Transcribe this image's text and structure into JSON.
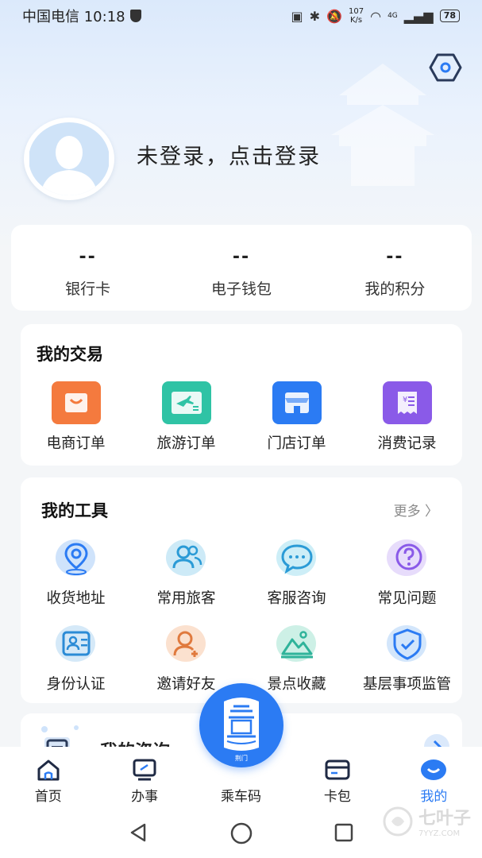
{
  "status_bar": {
    "carrier_time": "中国电信 10:18",
    "net_speed_value": "107",
    "net_speed_unit": "K/s",
    "signal_label": "4G",
    "battery": "78"
  },
  "profile": {
    "login_prompt": "未登录，点击登录"
  },
  "assets": [
    {
      "value": "--",
      "label": "银行卡"
    },
    {
      "value": "--",
      "label": "电子钱包"
    },
    {
      "value": "--",
      "label": "我的积分"
    }
  ],
  "trade": {
    "title": "我的交易",
    "items": [
      {
        "label": "电商订单",
        "icon": "shopping-bag-icon",
        "color": "#f47a3e"
      },
      {
        "label": "旅游订单",
        "icon": "airplane-ticket-icon",
        "color": "#2fc3a5"
      },
      {
        "label": "门店订单",
        "icon": "store-icon",
        "color": "#2b7bf3"
      },
      {
        "label": "消费记录",
        "icon": "receipt-icon",
        "color": "#8a5ae8"
      }
    ]
  },
  "tools": {
    "title": "我的工具",
    "more": "更多",
    "items": [
      {
        "label": "收货地址",
        "icon": "location-pin-icon",
        "color": "#2b7bf3",
        "bg": "#cfe3fb"
      },
      {
        "label": "常用旅客",
        "icon": "users-icon",
        "color": "#2b9bd6",
        "bg": "#cdeaf7"
      },
      {
        "label": "客服咨询",
        "icon": "chat-bubble-icon",
        "color": "#2b9bd6",
        "bg": "#cdeef7"
      },
      {
        "label": "常见问题",
        "icon": "question-icon",
        "color": "#8a5ae8",
        "bg": "#e7dcfb"
      },
      {
        "label": "身份认证",
        "icon": "id-card-icon",
        "color": "#2b8bd6",
        "bg": "#d5e9f8"
      },
      {
        "label": "邀请好友",
        "icon": "invite-user-icon",
        "color": "#e07a3e",
        "bg": "#fbe1cf"
      },
      {
        "label": "景点收藏",
        "icon": "landscape-icon",
        "color": "#2fb39a",
        "bg": "#cdf0e6"
      },
      {
        "label": "基层事项监管",
        "icon": "shield-check-icon",
        "color": "#2b7bf3",
        "bg": "#d3e6fb"
      }
    ]
  },
  "consult": {
    "title": "我的咨询"
  },
  "tabs": [
    {
      "label": "首页",
      "icon": "home-icon"
    },
    {
      "label": "办事",
      "icon": "monitor-icon"
    },
    {
      "label": "乘车码",
      "icon": "transit-code-icon"
    },
    {
      "label": "卡包",
      "icon": "card-icon"
    },
    {
      "label": "我的",
      "icon": "smile-icon"
    }
  ],
  "fab_caption": "荆门",
  "watermark": {
    "text": "七叶子",
    "sub": "7YYZ.COM"
  },
  "colors": {
    "accent": "#2b7bf3",
    "background": "#f4f6f8"
  }
}
